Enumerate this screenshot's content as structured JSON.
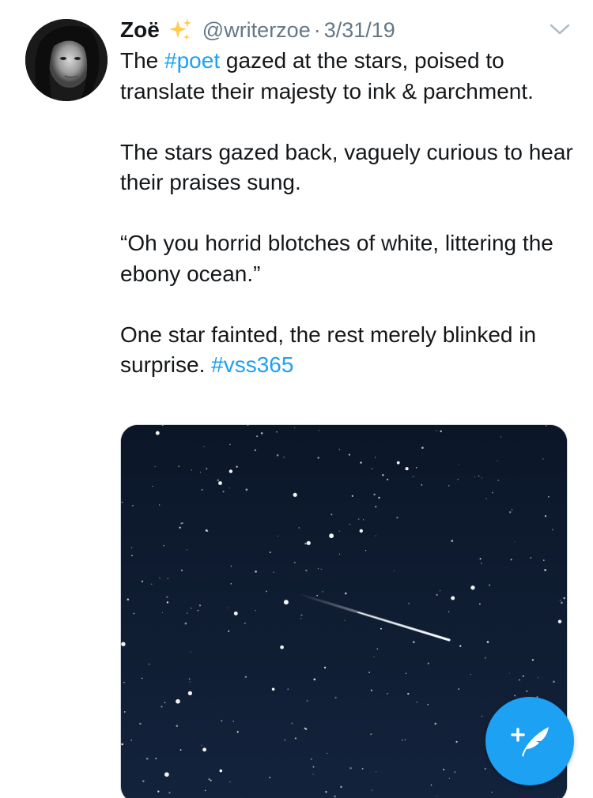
{
  "tweet": {
    "author": {
      "display_name": "Zoë",
      "emoji_icon": "sparkles-icon",
      "handle": "@writerzoe",
      "separator": "·",
      "date": "3/31/19"
    },
    "menu_icon": "chevron-down-icon",
    "body": {
      "p1_before": "The ",
      "p1_hashtag": "#poet",
      "p1_after": " gazed at the stars, poised to translate their majesty to ink & parchment.",
      "p2": "The stars gazed back, vaguely curious to hear their praises sung.",
      "p3": "“Oh you horrid blotches of white, littering the ebony ocean.”",
      "p4_before": "One star fainted, the rest merely blinked in surprise. ",
      "p4_hashtag": "#vss365"
    },
    "media": {
      "description": "shooting-star-night-sky-image"
    }
  },
  "compose_button": {
    "icon": "compose-tweet-icon"
  },
  "colors": {
    "accent": "#1da1f2",
    "text_primary": "#14171a",
    "text_secondary": "#657786",
    "image_sky": "#0f1b2e"
  }
}
